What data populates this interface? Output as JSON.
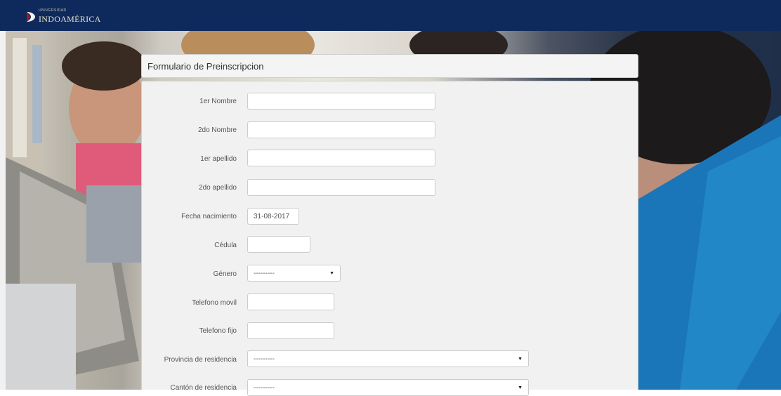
{
  "header": {
    "logo_sup": "UNIVERSIDAD",
    "logo_name": "INDOAMÉRICA"
  },
  "form": {
    "title": "Formulario de Preinscripcion",
    "fields": {
      "primer_nombre": {
        "label": "1er Nombre",
        "value": ""
      },
      "segundo_nombre": {
        "label": "2do Nombre",
        "value": ""
      },
      "primer_apellido": {
        "label": "1er apellido",
        "value": ""
      },
      "segundo_apellido": {
        "label": "2do apellido",
        "value": ""
      },
      "fecha_nacimiento": {
        "label": "Fecha nacimiento",
        "value": "31-08-2017"
      },
      "cedula": {
        "label": "Cédula",
        "value": ""
      },
      "genero": {
        "label": "Género",
        "value": "---------"
      },
      "telefono_movil": {
        "label": "Telefono movil",
        "value": ""
      },
      "telefono_fijo": {
        "label": "Telefono fijo",
        "value": ""
      },
      "provincia": {
        "label": "Provincia de residencia",
        "value": "---------"
      },
      "canton": {
        "label": "Cantón de residencia",
        "value": "---------"
      }
    }
  }
}
